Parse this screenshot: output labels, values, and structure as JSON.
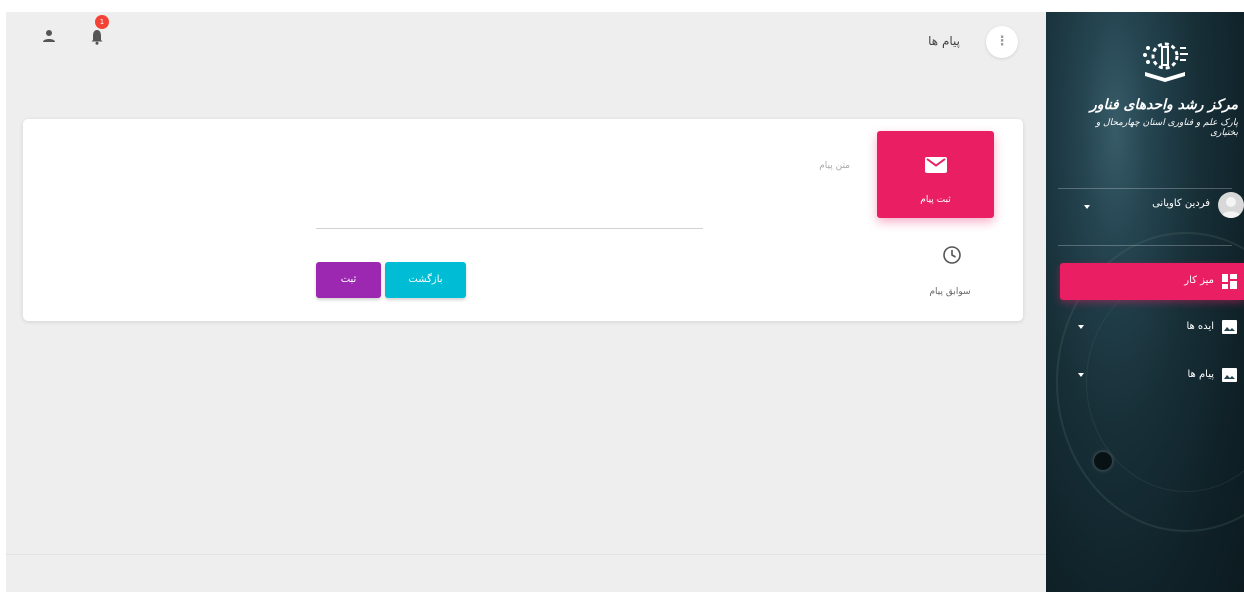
{
  "header": {
    "title": "پیام ها",
    "notification_count": "1",
    "menu_glyph": "⋮"
  },
  "form": {
    "tab_new_message": "ثبت پیام",
    "tab_history": "سوابق پیام",
    "message_field_label": "متن پیام",
    "message_value": "",
    "submit_label": "ثبت",
    "back_label": "بازگشت"
  },
  "sidebar": {
    "logo_title": "مرکز رشد واحدهای فناور",
    "logo_subtitle": "پارک علم و فناوری استان چهارمحال و بختیاری",
    "user_name": "فردین کاویانی",
    "items": [
      {
        "label": "میز کار",
        "icon": "dashboard-icon",
        "active": true
      },
      {
        "label": "ایده ها",
        "icon": "image-icon",
        "active": false
      },
      {
        "label": "پیام ها",
        "icon": "image-icon",
        "active": false
      }
    ]
  },
  "colors": {
    "accent_pink": "#e91e63",
    "submit_purple": "#9c27b0",
    "back_cyan": "#00bcd4",
    "badge_red": "#f44336",
    "content_bg": "#eeeeee"
  },
  "icons": [
    "person-icon",
    "bell-icon",
    "more-vert-icon",
    "envelope-icon",
    "clock-icon",
    "logo-icon",
    "dashboard-icon",
    "image-icon",
    "caret-down-icon"
  ]
}
